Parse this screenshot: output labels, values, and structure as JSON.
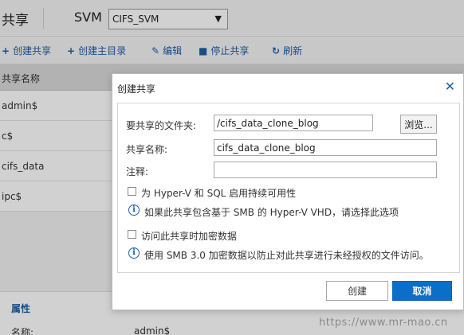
{
  "header": {
    "title": "共享",
    "svm_label": "SVM",
    "svm_selected": "CIFS_SVM"
  },
  "toolbar": {
    "create_share": "创建共享",
    "create_home_dir": "创建主目录",
    "edit": "编辑",
    "stop_share": "停止共享",
    "refresh": "刷新"
  },
  "table": {
    "column_share_name": "共享名称",
    "rows": [
      "admin$",
      "c$",
      "cifs_data",
      "ipc$"
    ]
  },
  "properties": {
    "title": "属性",
    "name_label": "名称:",
    "name_value": "admin$"
  },
  "dialog": {
    "title": "创建共享",
    "folder_label": "要共享的文件夹:",
    "folder_value": "/cifs_data_clone_blog",
    "browse_label": "浏览...",
    "share_name_label": "共享名称:",
    "share_name_value": "cifs_data_clone_blog",
    "comment_label": "注释:",
    "comment_value": "",
    "hyperv_checkbox_label": "为 Hyper-V 和 SQL 启用持续可用性",
    "hyperv_info": "如果此共享包含基于 SMB 的 Hyper-V VHD，请选择此选项",
    "encrypt_checkbox_label": "访问此共享时加密数据",
    "encrypt_info": "使用 SMB 3.0 加密数据以防止对此共享进行未经授权的文件访问。",
    "create_button": "创建",
    "cancel_button": "取消"
  },
  "watermark": "https://www.mr-mao.cn"
}
